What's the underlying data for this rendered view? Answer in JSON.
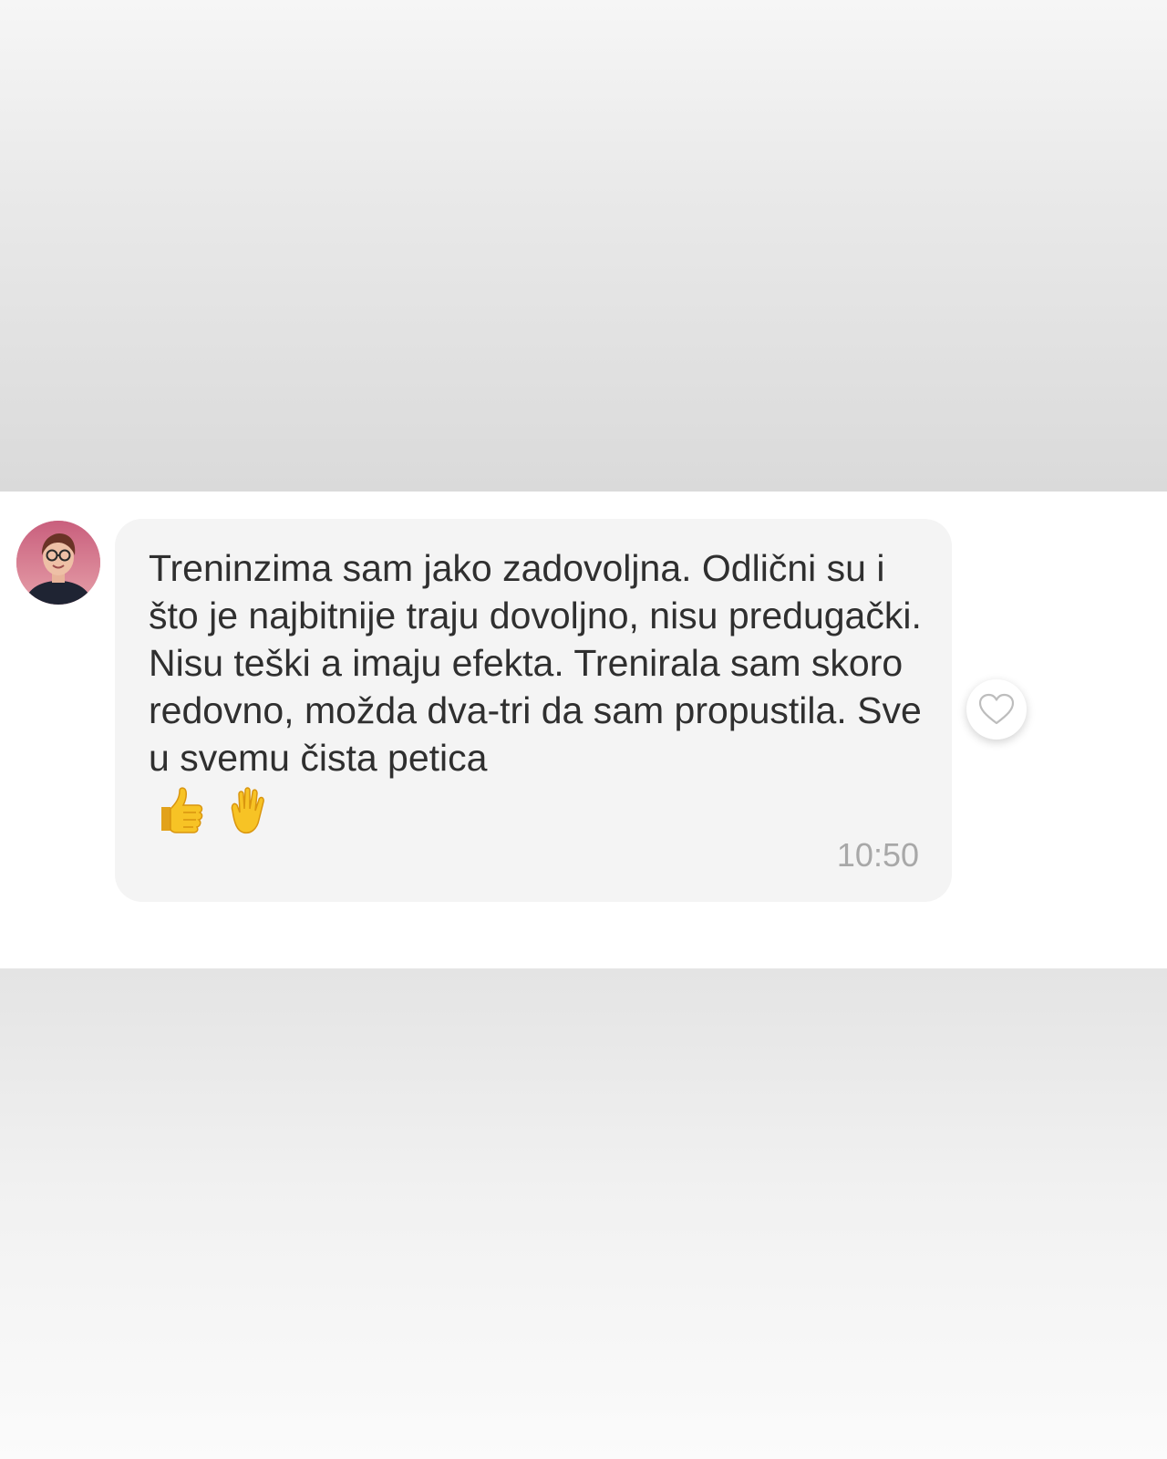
{
  "message": {
    "text": "Treninzima sam jako zadovoljna. Odlični su i što je najbitnije traju dovoljno, nisu predugački. Nisu teški a imaju efekta. Trenirala sam skoro redovno, možda dva-tri da sam propustila. Sve u svemu čista petica",
    "emojis": [
      "thumbs-up-icon",
      "raised-hand-icon"
    ],
    "time": "10:50"
  },
  "avatar": {
    "icon": "user-avatar-photo"
  },
  "reaction": {
    "icon": "heart-outline-icon"
  },
  "colors": {
    "bubble": "#f4f4f4",
    "text": "#2f2f2f",
    "timestamp": "#a8a8a8",
    "emoji_yellow": "#f7c325"
  }
}
